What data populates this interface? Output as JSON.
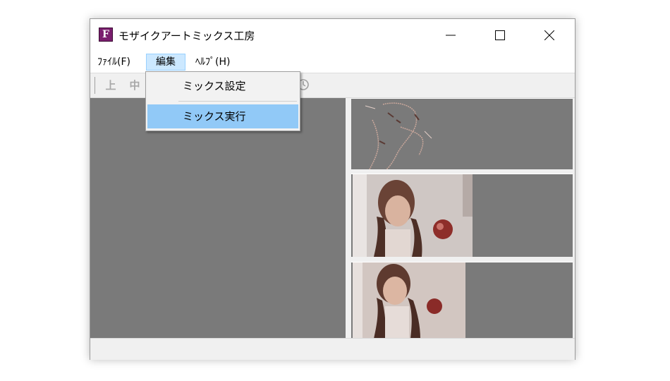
{
  "window": {
    "title": "モザイクアートミックス工房",
    "app_icon_letter": "F",
    "controls": {
      "minimize": "minimize",
      "maximize": "maximize",
      "close": "close"
    }
  },
  "menubar": {
    "items": [
      {
        "label": "ﾌｧｲﾙ(F)"
      },
      {
        "label": "編集"
      },
      {
        "label": "ﾍﾙﾌﾟ(H)"
      }
    ],
    "open_menu": "編集"
  },
  "toolbar": {
    "buttons": [
      {
        "label": "上",
        "icon": "align-top-icon",
        "enabled": false
      },
      {
        "label": "中",
        "icon": "align-middle-icon",
        "enabled": false
      },
      {
        "label": "",
        "icon": "clock-icon",
        "enabled": false
      }
    ]
  },
  "dropdown": {
    "items": [
      {
        "label": "ミックス設定",
        "highlighted": false
      },
      {
        "label": "ミックス実行",
        "highlighted": true
      }
    ]
  },
  "panes": {
    "left": {
      "content": "empty"
    },
    "thumbnails": [
      {
        "name": "mosaic-image-1"
      },
      {
        "name": "mosaic-image-2"
      },
      {
        "name": "mosaic-image-3"
      }
    ]
  },
  "colors": {
    "menu_open_bg": "#cce8ff",
    "dropdown_highlight": "#91c9f7",
    "pane_gray": "#7a7a7a",
    "app_icon": "#7a1e6e"
  }
}
